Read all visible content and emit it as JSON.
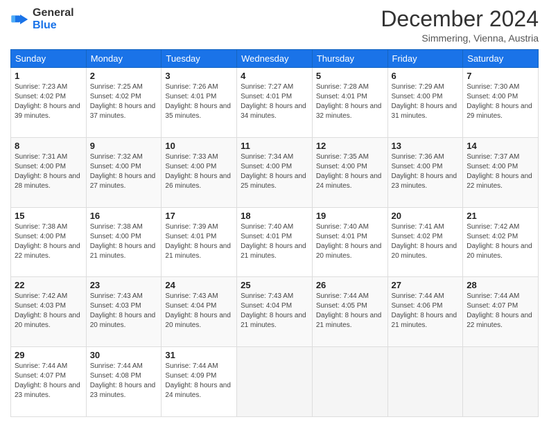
{
  "header": {
    "logo_general": "General",
    "logo_blue": "Blue",
    "month_title": "December 2024",
    "location": "Simmering, Vienna, Austria"
  },
  "weekdays": [
    "Sunday",
    "Monday",
    "Tuesday",
    "Wednesday",
    "Thursday",
    "Friday",
    "Saturday"
  ],
  "weeks": [
    [
      {
        "day": 1,
        "rise": "7:23 AM",
        "set": "4:02 PM",
        "daylight": "8 hours and 39 minutes"
      },
      {
        "day": 2,
        "rise": "7:25 AM",
        "set": "4:02 PM",
        "daylight": "8 hours and 37 minutes"
      },
      {
        "day": 3,
        "rise": "7:26 AM",
        "set": "4:01 PM",
        "daylight": "8 hours and 35 minutes"
      },
      {
        "day": 4,
        "rise": "7:27 AM",
        "set": "4:01 PM",
        "daylight": "8 hours and 34 minutes"
      },
      {
        "day": 5,
        "rise": "7:28 AM",
        "set": "4:01 PM",
        "daylight": "8 hours and 32 minutes"
      },
      {
        "day": 6,
        "rise": "7:29 AM",
        "set": "4:00 PM",
        "daylight": "8 hours and 31 minutes"
      },
      {
        "day": 7,
        "rise": "7:30 AM",
        "set": "4:00 PM",
        "daylight": "8 hours and 29 minutes"
      }
    ],
    [
      {
        "day": 8,
        "rise": "7:31 AM",
        "set": "4:00 PM",
        "daylight": "8 hours and 28 minutes"
      },
      {
        "day": 9,
        "rise": "7:32 AM",
        "set": "4:00 PM",
        "daylight": "8 hours and 27 minutes"
      },
      {
        "day": 10,
        "rise": "7:33 AM",
        "set": "4:00 PM",
        "daylight": "8 hours and 26 minutes"
      },
      {
        "day": 11,
        "rise": "7:34 AM",
        "set": "4:00 PM",
        "daylight": "8 hours and 25 minutes"
      },
      {
        "day": 12,
        "rise": "7:35 AM",
        "set": "4:00 PM",
        "daylight": "8 hours and 24 minutes"
      },
      {
        "day": 13,
        "rise": "7:36 AM",
        "set": "4:00 PM",
        "daylight": "8 hours and 23 minutes"
      },
      {
        "day": 14,
        "rise": "7:37 AM",
        "set": "4:00 PM",
        "daylight": "8 hours and 22 minutes"
      }
    ],
    [
      {
        "day": 15,
        "rise": "7:38 AM",
        "set": "4:00 PM",
        "daylight": "8 hours and 22 minutes"
      },
      {
        "day": 16,
        "rise": "7:38 AM",
        "set": "4:00 PM",
        "daylight": "8 hours and 21 minutes"
      },
      {
        "day": 17,
        "rise": "7:39 AM",
        "set": "4:01 PM",
        "daylight": "8 hours and 21 minutes"
      },
      {
        "day": 18,
        "rise": "7:40 AM",
        "set": "4:01 PM",
        "daylight": "8 hours and 21 minutes"
      },
      {
        "day": 19,
        "rise": "7:40 AM",
        "set": "4:01 PM",
        "daylight": "8 hours and 20 minutes"
      },
      {
        "day": 20,
        "rise": "7:41 AM",
        "set": "4:02 PM",
        "daylight": "8 hours and 20 minutes"
      },
      {
        "day": 21,
        "rise": "7:42 AM",
        "set": "4:02 PM",
        "daylight": "8 hours and 20 minutes"
      }
    ],
    [
      {
        "day": 22,
        "rise": "7:42 AM",
        "set": "4:03 PM",
        "daylight": "8 hours and 20 minutes"
      },
      {
        "day": 23,
        "rise": "7:43 AM",
        "set": "4:03 PM",
        "daylight": "8 hours and 20 minutes"
      },
      {
        "day": 24,
        "rise": "7:43 AM",
        "set": "4:04 PM",
        "daylight": "8 hours and 20 minutes"
      },
      {
        "day": 25,
        "rise": "7:43 AM",
        "set": "4:04 PM",
        "daylight": "8 hours and 21 minutes"
      },
      {
        "day": 26,
        "rise": "7:44 AM",
        "set": "4:05 PM",
        "daylight": "8 hours and 21 minutes"
      },
      {
        "day": 27,
        "rise": "7:44 AM",
        "set": "4:06 PM",
        "daylight": "8 hours and 21 minutes"
      },
      {
        "day": 28,
        "rise": "7:44 AM",
        "set": "4:07 PM",
        "daylight": "8 hours and 22 minutes"
      }
    ],
    [
      {
        "day": 29,
        "rise": "7:44 AM",
        "set": "4:07 PM",
        "daylight": "8 hours and 23 minutes"
      },
      {
        "day": 30,
        "rise": "7:44 AM",
        "set": "4:08 PM",
        "daylight": "8 hours and 23 minutes"
      },
      {
        "day": 31,
        "rise": "7:44 AM",
        "set": "4:09 PM",
        "daylight": "8 hours and 24 minutes"
      },
      null,
      null,
      null,
      null
    ]
  ]
}
